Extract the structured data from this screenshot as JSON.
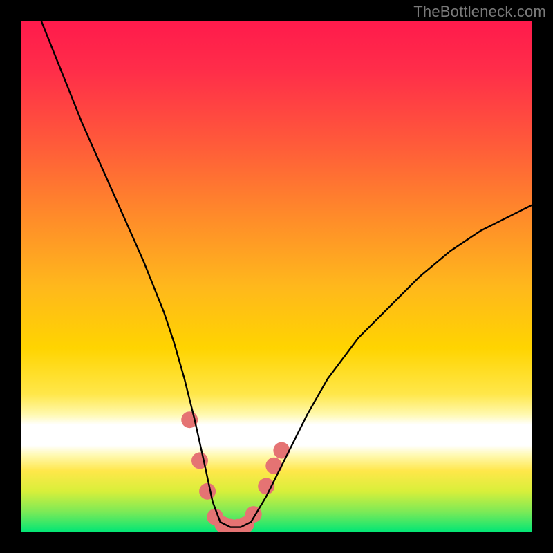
{
  "watermark": {
    "text": "TheBottleneck.com"
  },
  "chart_data": {
    "type": "line",
    "title": "",
    "xlabel": "",
    "ylabel": "",
    "xlim": [
      0,
      100
    ],
    "ylim": [
      0,
      100
    ],
    "grid": false,
    "legend": false,
    "background_gradient": {
      "top_color": "#ff1a4c",
      "mid_color": "#ffd400",
      "bottom_color": "#00e676",
      "white_band_y_range": [
        18,
        26
      ]
    },
    "series": [
      {
        "name": "bottleneck-curve",
        "color": "#000000",
        "x": [
          4,
          8,
          12,
          16,
          20,
          24,
          28,
          30,
          32,
          34,
          36,
          37.5,
          39,
          41,
          43,
          45,
          48,
          52,
          56,
          60,
          66,
          72,
          78,
          84,
          90,
          96,
          100
        ],
        "values": [
          100,
          90,
          80,
          71,
          62,
          53,
          43,
          37,
          30,
          22,
          13,
          6,
          2,
          1,
          1,
          2,
          7,
          15,
          23,
          30,
          38,
          44,
          50,
          55,
          59,
          62,
          64
        ]
      }
    ],
    "annotations": [
      {
        "name": "pink-marker-blob",
        "type": "marker_cluster",
        "color": "#e57373",
        "points": [
          {
            "x": 33,
            "y": 22
          },
          {
            "x": 35,
            "y": 14
          },
          {
            "x": 36.5,
            "y": 8
          },
          {
            "x": 38,
            "y": 3
          },
          {
            "x": 39.5,
            "y": 1.5
          },
          {
            "x": 41,
            "y": 1
          },
          {
            "x": 42.5,
            "y": 1
          },
          {
            "x": 44,
            "y": 1.5
          },
          {
            "x": 45.5,
            "y": 3.5
          },
          {
            "x": 48,
            "y": 9
          },
          {
            "x": 49.5,
            "y": 13
          },
          {
            "x": 51,
            "y": 16
          }
        ]
      }
    ]
  }
}
